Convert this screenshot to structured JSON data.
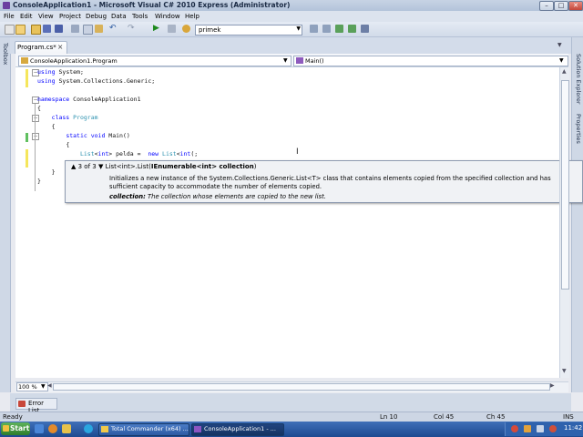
{
  "window": {
    "title": "ConsoleApplication1 - Microsoft Visual C# 2010 Express (Administrator)"
  },
  "menu": [
    "File",
    "Edit",
    "View",
    "Project",
    "Debug",
    "Data",
    "Tools",
    "Window",
    "Help"
  ],
  "toolbar": {
    "config_value": "primek"
  },
  "toolbox_label": "Toolbox",
  "right_labels": {
    "solution_explorer": "Solution Explorer",
    "properties": "Properties"
  },
  "tab": {
    "label": "Program.cs*",
    "close": "×"
  },
  "nav": {
    "class_value": "ConsoleApplication1.Program",
    "member_value": "Main()"
  },
  "code": {
    "lines": [
      {
        "indent": "",
        "parts": [
          [
            "kw",
            "using"
          ],
          [
            "",
            "System;"
          ]
        ]
      },
      {
        "indent": "",
        "parts": [
          [
            "kw",
            "using"
          ],
          [
            "",
            "System.Collections.Generic;"
          ]
        ]
      },
      {
        "indent": "",
        "parts": []
      },
      {
        "indent": "",
        "parts": [
          [
            "kw",
            "namespace"
          ],
          [
            "",
            "ConsoleApplication1"
          ]
        ]
      },
      {
        "indent": "",
        "parts": [
          [
            "",
            "{"
          ]
        ]
      },
      {
        "indent": "    ",
        "parts": [
          [
            "kw",
            "class"
          ],
          [
            "ty",
            "Program"
          ]
        ]
      },
      {
        "indent": "    ",
        "parts": [
          [
            "",
            "{"
          ]
        ]
      },
      {
        "indent": "        ",
        "parts": [
          [
            "kw",
            "static"
          ],
          [
            "kw",
            "void"
          ],
          [
            "",
            "Main()"
          ]
        ]
      },
      {
        "indent": "        ",
        "parts": [
          [
            "",
            "{"
          ]
        ]
      },
      {
        "indent": "            ",
        "parts": [
          [
            "ty",
            "List"
          ],
          [
            "",
            "<"
          ],
          [
            "kw",
            "int"
          ],
          [
            "",
            "> pelda = "
          ],
          [
            "kw",
            "new"
          ],
          [
            "ty",
            "List"
          ],
          [
            "",
            "<"
          ],
          [
            "kw",
            "int"
          ],
          [
            "",
            "(;"
          ]
        ]
      },
      {
        "indent": "        ",
        "parts": [
          [
            "",
            "}"
          ]
        ]
      },
      {
        "indent": "    ",
        "parts": [
          [
            "",
            "}"
          ]
        ]
      },
      {
        "indent": "",
        "parts": [
          [
            "",
            "}"
          ]
        ]
      }
    ]
  },
  "tooltip": {
    "counter": "3 of 3",
    "signature": "List<int>.List(",
    "param_bold": "IEnumerable<int> collection",
    "signature_end": ")",
    "description": "Initializes a new instance of the System.Collections.Generic.List<T> class that contains elements copied from the specified collection and has sufficient capacity to accommodate the number of elements copied.",
    "param_name": "collection:",
    "param_desc": "The collection whose elements are copied to the new list."
  },
  "zoom": "100 %",
  "error_list": "Error List",
  "status": {
    "ready": "Ready",
    "ln": "Ln 10",
    "col": "Col 45",
    "ch": "Ch 45",
    "ins": "INS"
  },
  "taskbar": {
    "start": "Start",
    "task1": "Total Commander (x64) ...",
    "task2": "ConsoleApplication1 - ...",
    "clock": "11:42"
  }
}
